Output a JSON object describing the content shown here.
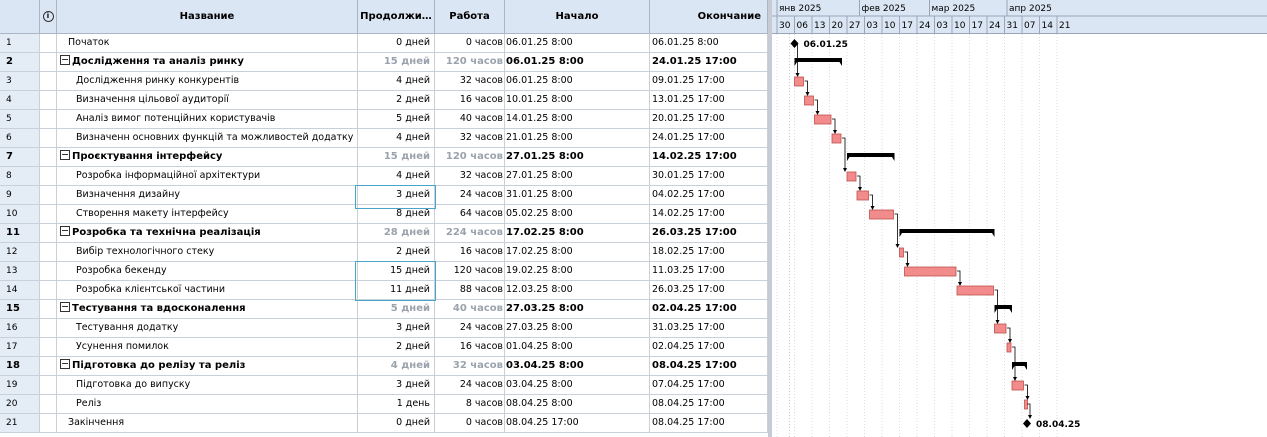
{
  "columns": {
    "indicator_icon": "info-circle-icon",
    "name": "Название",
    "duration": "Продолжи…",
    "work": "Работа",
    "start": "Начало",
    "finish": "Окончание"
  },
  "rows": [
    {
      "id": "1",
      "kind": "milestone-top",
      "name": "Початок",
      "duration": "0 дней",
      "work": "0 часов",
      "start": "06.01.25 8:00",
      "finish": "06.01.25 8:00",
      "gantt_label": "06.01.25"
    },
    {
      "id": "2",
      "kind": "summary",
      "name": "Дослідження та аналіз ринку",
      "duration": "15 дней",
      "work": "120 часов",
      "start": "06.01.25 8:00",
      "finish": "24.01.25 17:00"
    },
    {
      "id": "3",
      "kind": "task",
      "name": "Дослідження ринку конкурентів",
      "duration": "4 дней",
      "work": "32 часов",
      "start": "06.01.25 8:00",
      "finish": "09.01.25 17:00"
    },
    {
      "id": "4",
      "kind": "task",
      "name": "Визначення цільової аудиторії",
      "duration": "2 дней",
      "work": "16 часов",
      "start": "10.01.25 8:00",
      "finish": "13.01.25 17:00"
    },
    {
      "id": "5",
      "kind": "task",
      "name": "Аналіз вимог потенційних користувачів",
      "duration": "5 дней",
      "work": "40 часов",
      "start": "14.01.25 8:00",
      "finish": "20.01.25 17:00"
    },
    {
      "id": "6",
      "kind": "task",
      "name": "Визначенн основних функцій та можливостей додатку",
      "duration": "4 дней",
      "work": "32 часов",
      "start": "21.01.25 8:00",
      "finish": "24.01.25 17:00"
    },
    {
      "id": "7",
      "kind": "summary",
      "name": "Проєктування інтерфейсу",
      "duration": "15 дней",
      "work": "120 часов",
      "start": "27.01.25 8:00",
      "finish": "14.02.25 17:00"
    },
    {
      "id": "8",
      "kind": "task",
      "name": "Розробка інформаційної архітектури",
      "duration": "4 дней",
      "work": "32 часов",
      "start": "27.01.25 8:00",
      "finish": "30.01.25 17:00"
    },
    {
      "id": "9",
      "kind": "task",
      "name": "Визначення дизайну",
      "duration": "3 дней",
      "work": "24 часов",
      "start": "31.01.25 8:00",
      "finish": "04.02.25 17:00"
    },
    {
      "id": "10",
      "kind": "task",
      "name": "Створення макету інтерфейсу",
      "duration": "8 дней",
      "work": "64 часов",
      "start": "05.02.25 8:00",
      "finish": "14.02.25 17:00"
    },
    {
      "id": "11",
      "kind": "summary",
      "name": "Розробка та технічна реалізація",
      "duration": "28 дней",
      "work": "224 часов",
      "start": "17.02.25 8:00",
      "finish": "26.03.25 17:00"
    },
    {
      "id": "12",
      "kind": "task",
      "name": "Вибір технологічного стеку",
      "duration": "2 дней",
      "work": "16 часов",
      "start": "17.02.25 8:00",
      "finish": "18.02.25 17:00"
    },
    {
      "id": "13",
      "kind": "task",
      "name": "Розробка бекенду",
      "duration": "15 дней",
      "work": "120 часов",
      "start": "19.02.25 8:00",
      "finish": "11.03.25 17:00"
    },
    {
      "id": "14",
      "kind": "task",
      "name": "Розробка клієнтської частини",
      "duration": "11 дней",
      "work": "88 часов",
      "start": "12.03.25 8:00",
      "finish": "26.03.25 17:00"
    },
    {
      "id": "15",
      "kind": "summary",
      "name": "Тестування та вдосконалення",
      "duration": "5 дней",
      "work": "40 часов",
      "start": "27.03.25 8:00",
      "finish": "02.04.25 17:00"
    },
    {
      "id": "16",
      "kind": "task",
      "name": "Тестування додатку",
      "duration": "3 дней",
      "work": "24 часов",
      "start": "27.03.25 8:00",
      "finish": "31.03.25 17:00"
    },
    {
      "id": "17",
      "kind": "task",
      "name": "Усунення помилок",
      "duration": "2 дней",
      "work": "16 часов",
      "start": "01.04.25 8:00",
      "finish": "02.04.25 17:00"
    },
    {
      "id": "18",
      "kind": "summary",
      "name": "Підготовка до релізу та реліз",
      "duration": "4 дней",
      "work": "32 часов",
      "start": "03.04.25 8:00",
      "finish": "08.04.25 17:00"
    },
    {
      "id": "19",
      "kind": "task",
      "name": "Підготовка до випуску",
      "duration": "3 дней",
      "work": "24 часов",
      "start": "03.04.25 8:00",
      "finish": "07.04.25 17:00"
    },
    {
      "id": "20",
      "kind": "task",
      "name": "Реліз",
      "duration": "1 день",
      "work": "8 часов",
      "start": "08.04.25 8:00",
      "finish": "08.04.25 17:00"
    },
    {
      "id": "21",
      "kind": "milestone-top",
      "name": "Закінчення",
      "duration": "0 дней",
      "work": "0 часов",
      "start": "08.04.25 17:00",
      "finish": "08.04.25 17:00",
      "gantt_label": "08.04.25"
    }
  ],
  "timescale": {
    "months": [
      "янв 2025",
      "фев 2025",
      "мар 2025",
      "апр 2025"
    ],
    "weeks": [
      "30",
      "06",
      "13",
      "20",
      "27",
      "03",
      "10",
      "17",
      "24",
      "03",
      "10",
      "17",
      "24",
      "31",
      "07",
      "14",
      "21"
    ]
  },
  "colors": {
    "header_bg": "#dbe6f4",
    "task_bar": "#f28b8b",
    "task_bar_border": "#c0504d",
    "summary_bar": "#000000",
    "selection_border": "#4aa3c8"
  }
}
